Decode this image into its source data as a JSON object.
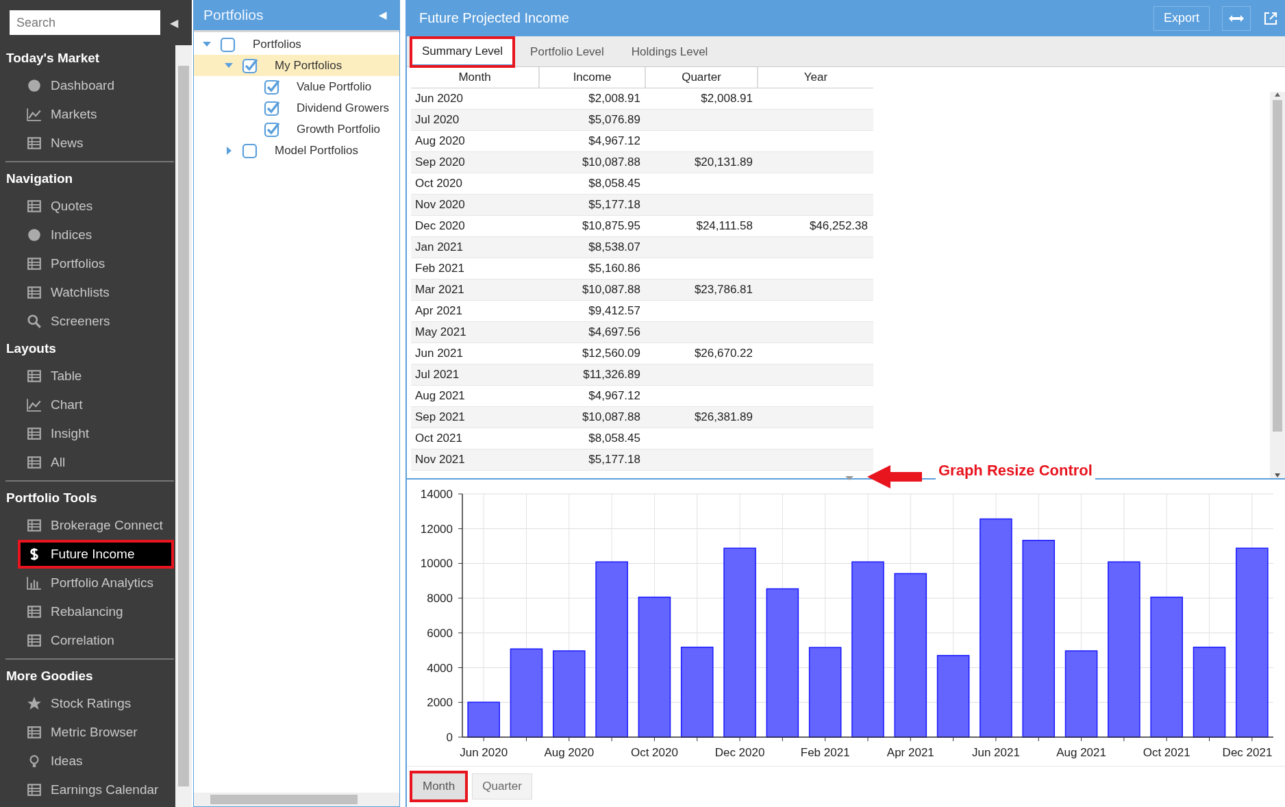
{
  "sidebar": {
    "search": {
      "placeholder": "Search"
    },
    "collapse_glyph": "◀",
    "sections": [
      {
        "title": "Today's Market",
        "divider_after": true,
        "items": [
          {
            "label": "Dashboard",
            "selected": false,
            "marked": false
          },
          {
            "label": "Markets",
            "selected": false,
            "marked": false
          },
          {
            "label": "News",
            "selected": false,
            "marked": false
          }
        ]
      },
      {
        "title": "Navigation",
        "divider_after": false,
        "items": [
          {
            "label": "Quotes",
            "selected": false,
            "marked": false
          },
          {
            "label": "Indices",
            "selected": false,
            "marked": false
          },
          {
            "label": "Portfolios",
            "selected": false,
            "marked": false
          },
          {
            "label": "Watchlists",
            "selected": false,
            "marked": false
          },
          {
            "label": "Screeners",
            "selected": false,
            "marked": false
          }
        ]
      },
      {
        "title": "Layouts",
        "divider_after": true,
        "items": [
          {
            "label": "Table",
            "selected": false,
            "marked": false
          },
          {
            "label": "Chart",
            "selected": false,
            "marked": false
          },
          {
            "label": "Insight",
            "selected": false,
            "marked": false
          },
          {
            "label": "All",
            "selected": false,
            "marked": false
          }
        ]
      },
      {
        "title": "Portfolio Tools",
        "divider_after": true,
        "items": [
          {
            "label": "Brokerage Connect",
            "selected": false,
            "marked": false
          },
          {
            "label": "Future Income",
            "selected": true,
            "marked": true
          },
          {
            "label": "Portfolio Analytics",
            "selected": false,
            "marked": false
          },
          {
            "label": "Rebalancing",
            "selected": false,
            "marked": false
          },
          {
            "label": "Correlation",
            "selected": false,
            "marked": false
          }
        ]
      },
      {
        "title": "More Goodies",
        "divider_after": false,
        "items": [
          {
            "label": "Stock Ratings",
            "selected": false,
            "marked": false
          },
          {
            "label": "Metric Browser",
            "selected": false,
            "marked": false
          },
          {
            "label": "Ideas",
            "selected": false,
            "marked": false
          },
          {
            "label": "Earnings Calendar",
            "selected": false,
            "marked": false
          }
        ]
      }
    ]
  },
  "portfolios_panel": {
    "title": "Portfolios",
    "collapse_glyph": "◀",
    "tree": [
      {
        "label": "Portfolios",
        "checked": false,
        "expanded": true,
        "selected": false,
        "children": [
          {
            "label": "My Portfolios",
            "checked": true,
            "expanded": true,
            "selected": true,
            "children": [
              {
                "label": "Value Portfolio",
                "checked": true,
                "selected": false
              },
              {
                "label": "Dividend Growers",
                "checked": true,
                "selected": false
              },
              {
                "label": "Growth Portfolio",
                "checked": true,
                "selected": false
              }
            ]
          },
          {
            "label": "Model Portfolios",
            "checked": false,
            "expanded": false,
            "selected": false
          }
        ]
      }
    ]
  },
  "main": {
    "title": "Future Projected Income",
    "export_button": "Export",
    "tabs": [
      {
        "label": "Summary Level",
        "selected": true,
        "marked": true
      },
      {
        "label": "Portfolio Level",
        "selected": false,
        "marked": false
      },
      {
        "label": "Holdings Level",
        "selected": false,
        "marked": false
      }
    ],
    "table": {
      "columns": [
        "Month",
        "Income",
        "Quarter",
        "Year"
      ],
      "rows": [
        {
          "month": "Jun 2020",
          "income": "$2,008.91",
          "quarter": "$2,008.91"
        },
        {
          "month": "Jul 2020",
          "income": "$5,076.89"
        },
        {
          "month": "Aug 2020",
          "income": "$4,967.12"
        },
        {
          "month": "Sep 2020",
          "income": "$10,087.88",
          "quarter": "$20,131.89"
        },
        {
          "month": "Oct 2020",
          "income": "$8,058.45"
        },
        {
          "month": "Nov 2020",
          "income": "$5,177.18"
        },
        {
          "month": "Dec 2020",
          "income": "$10,875.95",
          "quarter": "$24,111.58",
          "year": "$46,252.38"
        },
        {
          "month": "Jan 2021",
          "income": "$8,538.07"
        },
        {
          "month": "Feb 2021",
          "income": "$5,160.86"
        },
        {
          "month": "Mar 2021",
          "income": "$10,087.88",
          "quarter": "$23,786.81"
        },
        {
          "month": "Apr 2021",
          "income": "$9,412.57"
        },
        {
          "month": "May 2021",
          "income": "$4,697.56"
        },
        {
          "month": "Jun 2021",
          "income": "$12,560.09",
          "quarter": "$26,670.22"
        },
        {
          "month": "Jul 2021",
          "income": "$11,326.89"
        },
        {
          "month": "Aug 2021",
          "income": "$4,967.12"
        },
        {
          "month": "Sep 2021",
          "income": "$10,087.88",
          "quarter": "$26,381.89"
        },
        {
          "month": "Oct 2021",
          "income": "$8,058.45"
        },
        {
          "month": "Nov 2021",
          "income": "$5,177.18"
        }
      ]
    },
    "callout": "Graph Resize Control",
    "chart_data": {
      "type": "bar",
      "categories": [
        "Jun 2020",
        null,
        "Aug 2020",
        null,
        "Oct 2020",
        null,
        "Dec 2020",
        null,
        "Feb 2021",
        null,
        "Apr 2021",
        null,
        "Jun 2021",
        null,
        "Aug 2021",
        null,
        "Oct 2021",
        null,
        "Dec 2021"
      ],
      "series": [
        {
          "color": "#6464ff",
          "values": [
            2009,
            5077,
            4967,
            10088,
            8058,
            5177,
            10876,
            8538,
            5161,
            10088,
            9413,
            4698,
            12560,
            11327,
            4967,
            10088,
            8058,
            5177,
            10876
          ]
        }
      ],
      "ylim": [
        0,
        14000
      ],
      "yticks": [
        0,
        2000,
        4000,
        6000,
        8000,
        10000,
        12000,
        14000
      ],
      "grid": true
    },
    "period_buttons": [
      {
        "label": "Month",
        "selected": true,
        "marked": true
      },
      {
        "label": "Quarter",
        "selected": false,
        "marked": false
      }
    ]
  }
}
